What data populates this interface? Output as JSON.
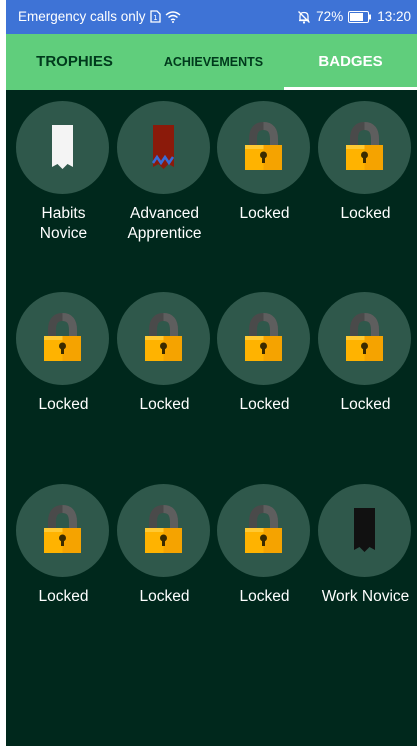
{
  "status_bar": {
    "carrier_text": "Emergency calls only",
    "battery": "72%",
    "time": "13:20",
    "icons": [
      "sim-icon",
      "wifi-icon",
      "mute-icon",
      "battery-icon"
    ]
  },
  "tabs": [
    {
      "label": "TROPHIES",
      "active": false
    },
    {
      "label": "ACHIEVEMENTS",
      "active": false
    },
    {
      "label": "BADGES",
      "active": true
    }
  ],
  "badges": [
    {
      "label": "Habits Novice",
      "state": "unlocked",
      "icon": "white-ribbon-icon",
      "ribbon_color": "#f4f4f4"
    },
    {
      "label": "Advanced Apprentice",
      "state": "unlocked",
      "icon": "red-ribbon-icon",
      "ribbon_color": "#8b1a0a"
    },
    {
      "label": "Locked",
      "state": "locked",
      "icon": "lock-icon"
    },
    {
      "label": "Locked",
      "state": "locked",
      "icon": "lock-icon"
    },
    {
      "label": "Locked",
      "state": "locked",
      "icon": "lock-icon"
    },
    {
      "label": "Locked",
      "state": "locked",
      "icon": "lock-icon"
    },
    {
      "label": "Locked",
      "state": "locked",
      "icon": "lock-icon"
    },
    {
      "label": "Locked",
      "state": "locked",
      "icon": "lock-icon"
    },
    {
      "label": "Locked",
      "state": "locked",
      "icon": "lock-icon"
    },
    {
      "label": "Locked",
      "state": "locked",
      "icon": "lock-icon"
    },
    {
      "label": "Locked",
      "state": "locked",
      "icon": "lock-icon"
    },
    {
      "label": "Work Novice",
      "state": "unlocked",
      "icon": "black-ribbon-icon",
      "ribbon_color": "#111111"
    }
  ],
  "colors": {
    "status_bar": "#3e73d6",
    "tab_bar": "#60ce7c",
    "background": "#00281c",
    "badge_circle": "#2f584b",
    "lock_body": "#ffb300",
    "lock_shackle": "#4a4a4a"
  }
}
